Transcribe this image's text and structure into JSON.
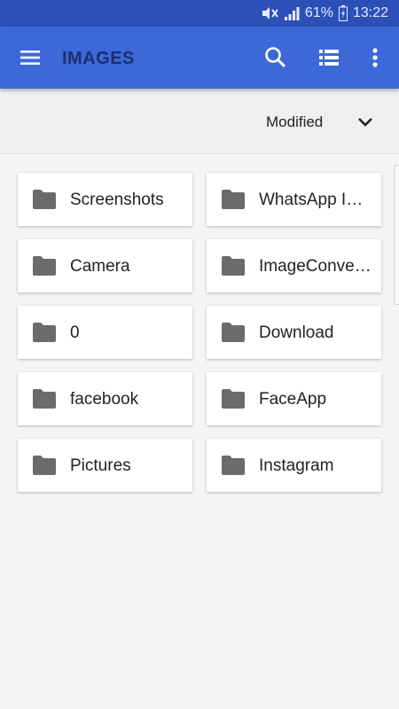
{
  "status_bar": {
    "battery": "61%",
    "time": "13:22"
  },
  "app_bar": {
    "title": "IMAGES",
    "icons": [
      "menu-icon",
      "search-icon",
      "list-view-icon",
      "more-vert-icon"
    ]
  },
  "sort_bar": {
    "label": "Modified",
    "icon": "chevron-down-icon"
  },
  "folders": [
    {
      "label": "Screenshots"
    },
    {
      "label": "WhatsApp Images"
    },
    {
      "label": "Camera"
    },
    {
      "label": "ImageConverter"
    },
    {
      "label": "0"
    },
    {
      "label": "Download"
    },
    {
      "label": "facebook"
    },
    {
      "label": "FaceApp"
    },
    {
      "label": "Pictures"
    },
    {
      "label": "Instagram"
    }
  ],
  "colors": {
    "status_bar": "#2c4fb8",
    "app_bar": "#3d68d8",
    "title": "#1c2f6e",
    "folder_icon": "#6b6b6b",
    "background": "#f5f5f5"
  }
}
